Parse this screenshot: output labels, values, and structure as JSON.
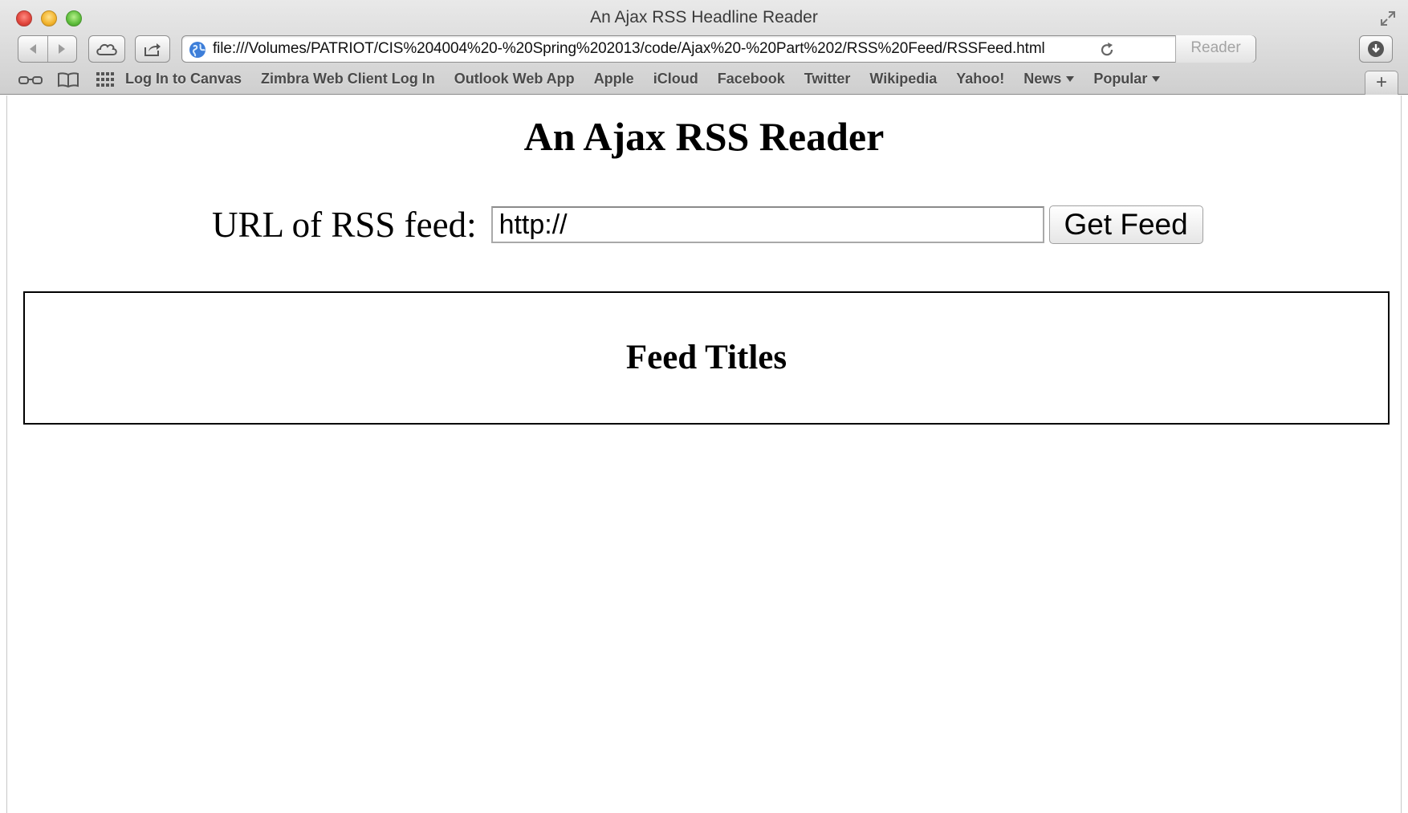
{
  "window": {
    "title": "An Ajax RSS Headline Reader"
  },
  "toolbar": {
    "url": "file:///Volumes/PATRIOT/CIS%204004%20-%20Spring%202013/code/Ajax%20-%20Part%202/RSS%20Feed/RSSFeed.html",
    "reader_label": "Reader"
  },
  "bookmarks": {
    "items": [
      {
        "label": "Log In to Canvas"
      },
      {
        "label": "Zimbra Web Client Log In"
      },
      {
        "label": "Outlook Web App"
      },
      {
        "label": "Apple"
      },
      {
        "label": "iCloud"
      },
      {
        "label": "Facebook"
      },
      {
        "label": "Twitter"
      },
      {
        "label": "Wikipedia"
      },
      {
        "label": "Yahoo!"
      },
      {
        "label": "News",
        "dropdown": true
      },
      {
        "label": "Popular",
        "dropdown": true
      }
    ],
    "new_tab_label": "+"
  },
  "page": {
    "title": "An Ajax RSS Reader",
    "url_label": "URL of RSS feed:",
    "url_value": "http://",
    "get_feed_label": "Get Feed",
    "feed_heading": "Feed Titles"
  }
}
